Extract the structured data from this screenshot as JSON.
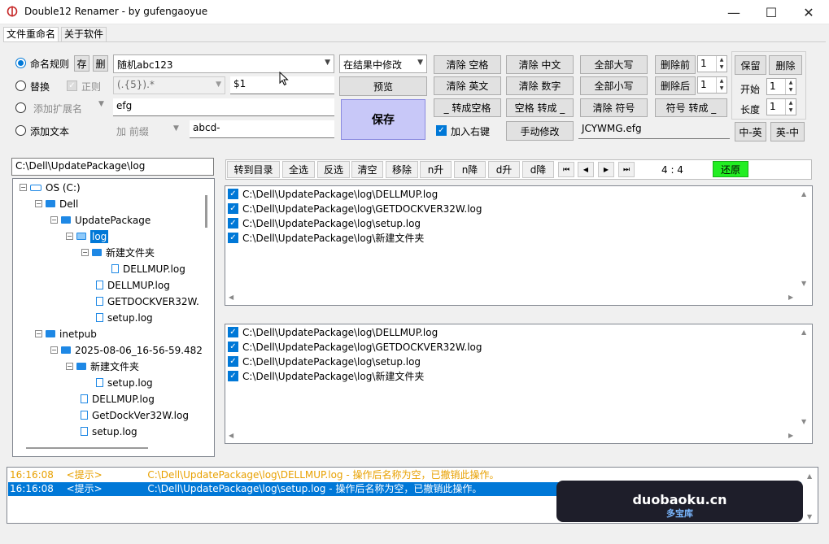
{
  "window": {
    "title": "Double12 Renamer - by gufengaoyue",
    "minimize": "—",
    "maximize": "☐",
    "close": "✕"
  },
  "tabs": [
    "文件重命名",
    "关于软件"
  ],
  "rules": {
    "naming_rule_label": "命名规则",
    "save_btn": "存",
    "delete_btn": "删",
    "naming_rule_value": "随机abc123",
    "replace_label": "替换",
    "regex_label": "正则",
    "replace_find": "(.{5}).*",
    "replace_with": "$1",
    "add_ext_label": "添加扩展名",
    "add_ext_value": "efg",
    "add_text_label": "添加文本",
    "add_text_position": "加 前缀",
    "add_text_value": "abcd-"
  },
  "actions": {
    "modify_mode": "在结果中修改",
    "preview": "预览",
    "save": "保存",
    "add_context_menu": "加入右键"
  },
  "ops": {
    "clear_space": "清除 空格",
    "clear_cn": "清除 中文",
    "all_upper": "全部大写",
    "delete_before": "删除前",
    "delete_before_val": "1",
    "keep": "保留",
    "delete": "删除",
    "clear_en": "清除 英文",
    "clear_num": "清除 数字",
    "all_lower": "全部小写",
    "delete_after": "删除后",
    "delete_after_val": "1",
    "start_label": "开始",
    "start_val": "1",
    "to_space": "_ 转成空格",
    "space_to": "空格 转成 _",
    "clear_symbol": "清除 符号",
    "symbol_to": "符号 转成 _",
    "length_label": "长度",
    "length_val": "1",
    "manual_modify": "手动修改",
    "manual_value": "JCYWMG.efg",
    "cn_en": "中-英",
    "en_cn": "英-中"
  },
  "path_input": "C:\\Dell\\UpdatePackage\\log",
  "tree": [
    {
      "label": "OS (C:)",
      "type": "drive"
    },
    {
      "label": "Dell",
      "type": "folder"
    },
    {
      "label": "UpdatePackage",
      "type": "folder"
    },
    {
      "label": "log",
      "type": "folder-open"
    },
    {
      "label": "新建文件夹",
      "type": "folder"
    },
    {
      "label": "DELLMUP.log",
      "type": "file"
    },
    {
      "label": "DELLMUP.log",
      "type": "file"
    },
    {
      "label": "GETDOCKVER32W.",
      "type": "file"
    },
    {
      "label": "setup.log",
      "type": "file"
    },
    {
      "label": "inetpub",
      "type": "folder"
    },
    {
      "label": "2025-08-06_16-56-59.482",
      "type": "folder"
    },
    {
      "label": "新建文件夹",
      "type": "folder"
    },
    {
      "label": "setup.log",
      "type": "file"
    },
    {
      "label": "DELLMUP.log",
      "type": "file"
    },
    {
      "label": "GetDockVer32W.log",
      "type": "file"
    },
    {
      "label": "setup.log",
      "type": "file"
    }
  ],
  "toolbar": {
    "goto_dir": "转到目录",
    "select_all": "全选",
    "invert": "反选",
    "clear": "清空",
    "remove": "移除",
    "n_asc": "n升",
    "n_desc": "n降",
    "d_asc": "d升",
    "d_desc": "d降",
    "first": "⏮",
    "prev": "◀",
    "next": "▶",
    "last": "⏭",
    "counter": "4 : 4",
    "restore": "还原"
  },
  "source_list": [
    "C:\\Dell\\UpdatePackage\\log\\DELLMUP.log",
    "C:\\Dell\\UpdatePackage\\log\\GETDOCKVER32W.log",
    "C:\\Dell\\UpdatePackage\\log\\setup.log",
    "C:\\Dell\\UpdatePackage\\log\\新建文件夹"
  ],
  "result_list": [
    "C:\\Dell\\UpdatePackage\\log\\DELLMUP.log",
    "C:\\Dell\\UpdatePackage\\log\\GETDOCKVER32W.log",
    "C:\\Dell\\UpdatePackage\\log\\setup.log",
    "C:\\Dell\\UpdatePackage\\log\\新建文件夹"
  ],
  "log": [
    {
      "time": "16:16:08",
      "tag": "<提示>",
      "msg": "C:\\Dell\\UpdatePackage\\log\\DELLMUP.log  - 操作后名称为空，已撤销此操作。"
    },
    {
      "time": "16:16:08",
      "tag": "<提示>",
      "msg": "C:\\Dell\\UpdatePackage\\log\\setup.log  - 操作后名称为空，已撤销此操作。"
    }
  ],
  "watermark": {
    "line1": "duobaoku.cn",
    "line2": "多宝库"
  },
  "colors": {
    "accent": "#0078d7",
    "save_bg": "#c8c8f8",
    "restore_bg": "#22ee22",
    "log_warn": "#e8a000"
  }
}
